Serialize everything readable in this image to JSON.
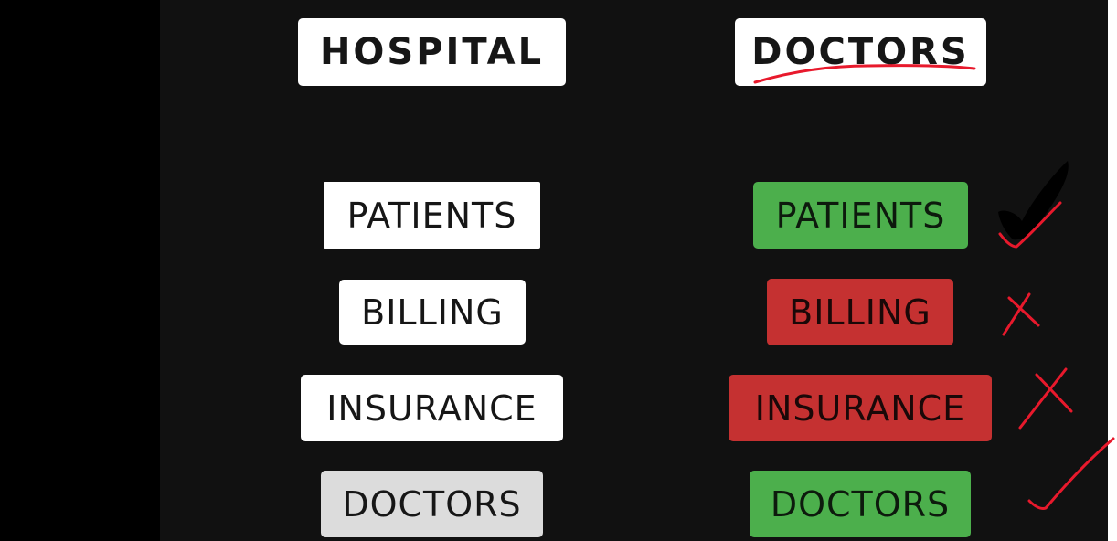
{
  "headers": {
    "left": "HOSPITAL",
    "right": "DOCTORS"
  },
  "left_column": [
    {
      "label": "PATIENTS"
    },
    {
      "label": "BILLING"
    },
    {
      "label": "INSURANCE"
    },
    {
      "label": "DOCTORS"
    }
  ],
  "right_column": [
    {
      "label": "PATIENTS",
      "status": "match",
      "color": "#4caf4c",
      "mark": "check-mark"
    },
    {
      "label": "BILLING",
      "status": "no-match",
      "color": "#c53131",
      "mark": "cross-mark"
    },
    {
      "label": "INSURANCE",
      "status": "no-match",
      "color": "#c53131",
      "mark": "cross-mark"
    },
    {
      "label": "DOCTORS",
      "status": "match",
      "color": "#4caf4c",
      "mark": "check-mark"
    }
  ],
  "colors": {
    "background": "#111111",
    "letterbox": "#000000",
    "label_white": "#ffffff",
    "match": "#4caf4c",
    "no_match": "#c53131",
    "annotation_ink": "#e8192c",
    "large_check": "#000000"
  }
}
